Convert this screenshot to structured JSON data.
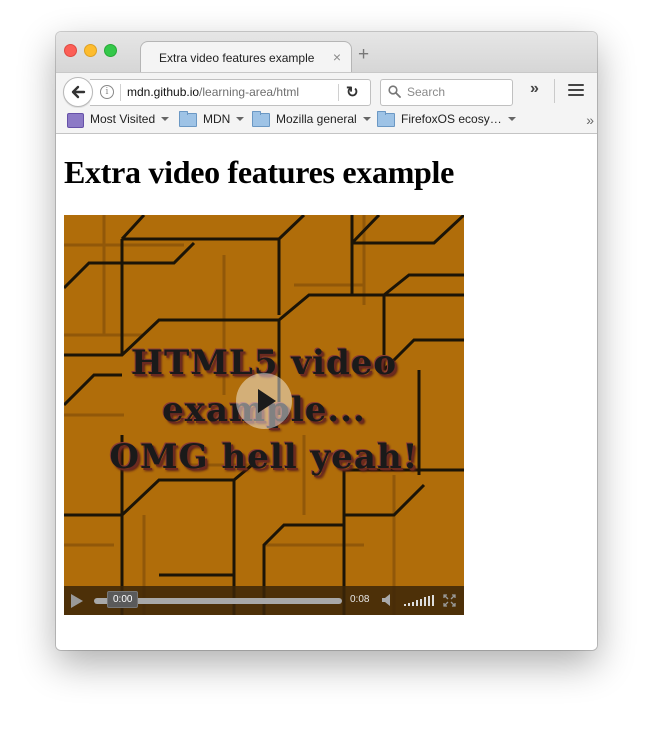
{
  "window": {
    "tab_title": "Extra video features example",
    "tab_close": "×",
    "new_tab": "+"
  },
  "navbar": {
    "url_host": "mdn.github.io",
    "url_path": "/learning-area/html",
    "search_placeholder": "Search",
    "overflow": "»"
  },
  "bookmarks": [
    {
      "label": "Most Visited",
      "icon": "most-visited-icon"
    },
    {
      "label": "MDN",
      "icon": "folder-icon"
    },
    {
      "label": "Mozilla general",
      "icon": "folder-icon"
    },
    {
      "label": "FirefoxOS ecosy…",
      "icon": "folder-icon"
    }
  ],
  "page": {
    "title": "Extra video features example"
  },
  "video": {
    "overlay_lines": [
      "HTML5 video",
      "example...",
      "OMG hell yeah!"
    ],
    "current_time": "0:00",
    "duration": "0:08",
    "progress": 0,
    "colors": {
      "frame_bg": "#b06d0a"
    }
  }
}
